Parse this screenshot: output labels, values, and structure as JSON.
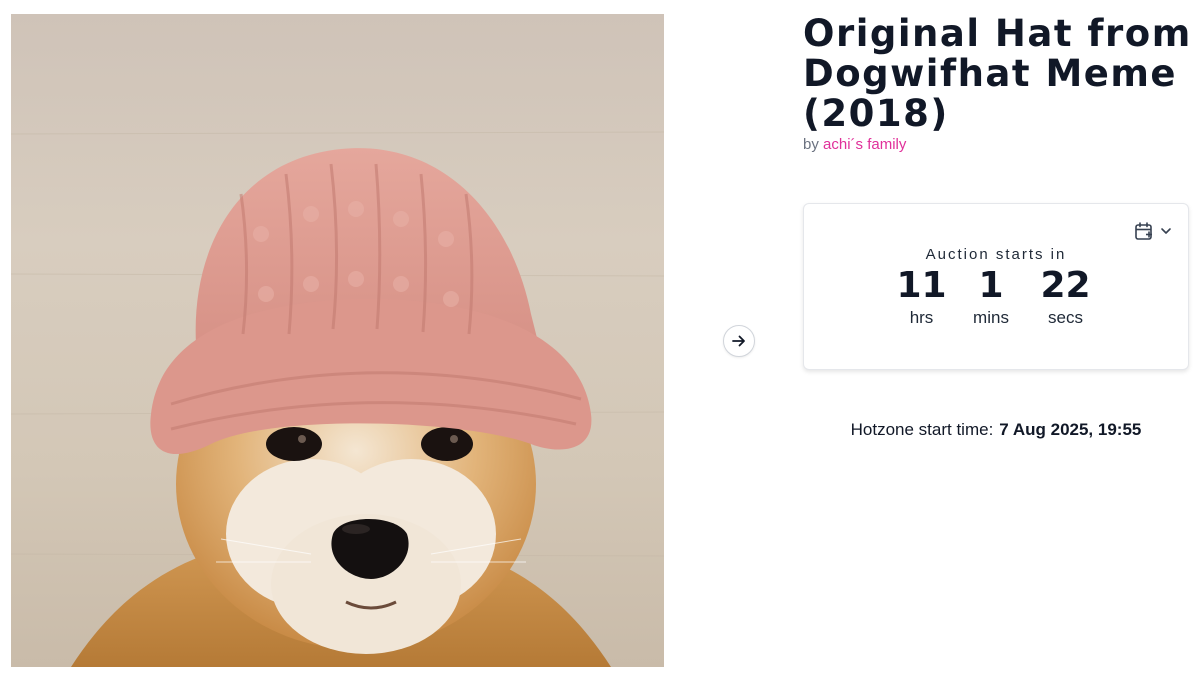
{
  "artwork": {
    "subject": "shiba-inu-in-pink-knit-hat",
    "alt": ""
  },
  "title": "Original Hat from Dogwifhat Meme (2018)",
  "byline": {
    "prefix": "by",
    "artist": "achi´s family"
  },
  "auction": {
    "label": "Auction starts in",
    "countdown": [
      {
        "value": "11",
        "unit": "hrs"
      },
      {
        "value": "1",
        "unit": "mins"
      },
      {
        "value": "22",
        "unit": "secs"
      }
    ],
    "calendar_icon": "calendar-plus-icon",
    "dropdown_icon": "chevron-down-icon"
  },
  "hotzone": {
    "label": "Hotzone start time:",
    "time": "7 Aug 2025, 19:55"
  },
  "nav": {
    "next_icon": "arrow-right-icon"
  },
  "colors": {
    "accent": "#e0309a",
    "text": "#111827",
    "muted": "#6b7280"
  }
}
